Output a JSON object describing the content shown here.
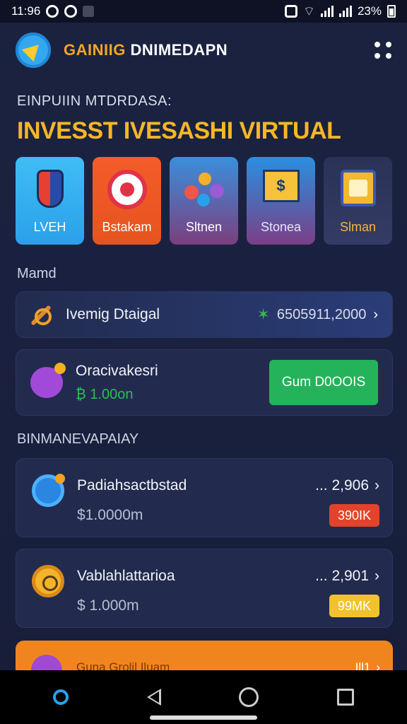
{
  "status_bar": {
    "time": "11:96",
    "battery": "23%"
  },
  "app_bar": {
    "title_accent": "GAINIIG",
    "title_main": "DNIMEDAPN",
    "menu_icon": "more-dots-icon",
    "logo_icon": "paper-plane-icon"
  },
  "hero": {
    "subtitle": "EINPUIIN MTDRDASA:",
    "headline": "INVESST IVESASHI VIRTUAL"
  },
  "categories": [
    {
      "label": "LVEH",
      "icon": "shield-icon"
    },
    {
      "label": "Bstakam",
      "icon": "target-icon"
    },
    {
      "label": "Sltnen",
      "icon": "molecule-icon"
    },
    {
      "label": "Stonea",
      "icon": "sign-icon"
    },
    {
      "label": "Slman",
      "icon": "treasure-chest-icon"
    }
  ],
  "section1": {
    "label": "Mamd"
  },
  "row_investment": {
    "title": "Ivemig Dtaigal",
    "value": "6505911,2000",
    "icon": "wrench-icon"
  },
  "row_balance": {
    "title": "Oracivakesri",
    "amount": "₿ 1.00on",
    "button": "Gum D0OOIS",
    "icon": "chat-bubble-icon"
  },
  "section2": {
    "label": "BINMANEVAPAIAY"
  },
  "investments": [
    {
      "name": "Padiahsactbstad",
      "amount": "$1.0000m",
      "value": "... 2,906",
      "badge": "390IK",
      "icon": "chat-blue-icon"
    },
    {
      "name": "Vablahlattarioa",
      "amount": "$ 1.000m",
      "value": "... 2,901",
      "badge": "99MK",
      "icon": "gold-coin-icon"
    }
  ],
  "promo": {
    "name": "Guna Grolil Iluam",
    "value": "Ill1"
  },
  "colors": {
    "accent": "#f6b726",
    "background": "#1a2140",
    "success": "#24b35a",
    "badge_red": "#e2432a",
    "badge_yellow": "#f2c22c",
    "promo_orange": "#f08520"
  }
}
